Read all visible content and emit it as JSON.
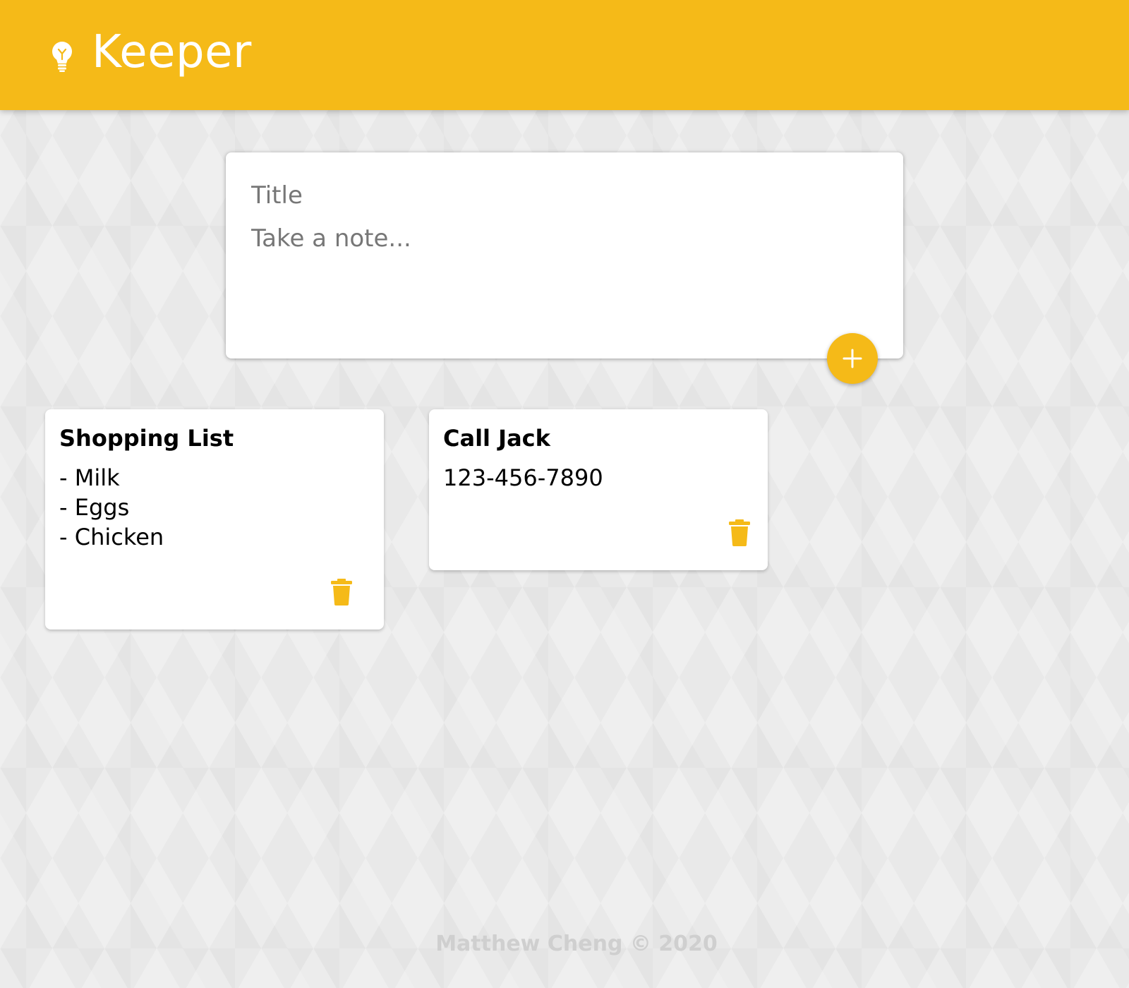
{
  "header": {
    "title": "Keeper",
    "icon": "lightbulb-icon",
    "color": "#f5ba18"
  },
  "create_area": {
    "title_placeholder": "Title",
    "content_placeholder": "Take a note...",
    "title_value": "",
    "content_value": "",
    "add_button_icon": "plus-icon"
  },
  "notes": [
    {
      "title": "Shopping List",
      "content": "- Milk\n- Eggs\n- Chicken",
      "delete_icon": "trash-icon"
    },
    {
      "title": "Call Jack",
      "content": "123-456-7890",
      "delete_icon": "trash-icon"
    }
  ],
  "footer": {
    "text": "Matthew Cheng © 2020"
  },
  "colors": {
    "accent": "#f5ba18",
    "card": "#ffffff",
    "background": "#e9e9e9",
    "footer_text": "#cfcfcf"
  }
}
